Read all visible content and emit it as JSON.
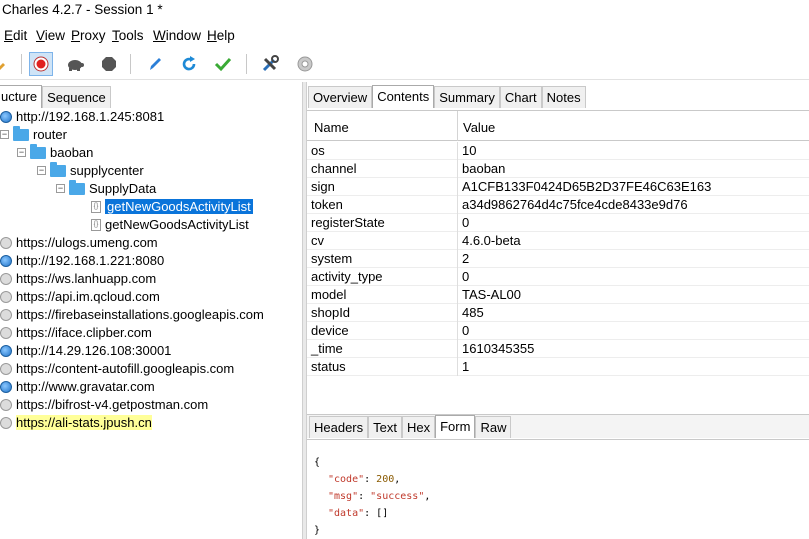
{
  "window": {
    "title": "Charles 4.2.7 - Session 1 *"
  },
  "menu": {
    "items": [
      {
        "u": "E",
        "rest": "dit"
      },
      {
        "u": "V",
        "rest": "iew"
      },
      {
        "u": "P",
        "rest": "roxy"
      },
      {
        "u": "T",
        "rest": "ools"
      },
      {
        "u": "W",
        "rest": "indow"
      },
      {
        "u": "H",
        "rest": "elp"
      }
    ]
  },
  "toolbar": {
    "icons": [
      "brush-icon",
      "record-icon",
      "throttle-turtle-icon",
      "breakpoint-hexagon-icon",
      "compose-pen-icon",
      "repeat-icon",
      "validate-check-icon",
      "tools-icon",
      "settings-gear-icon"
    ]
  },
  "left": {
    "tabs": [
      "ucture",
      "Sequence"
    ],
    "tree": [
      {
        "text": "http://192.168.1.245:8081",
        "icon": "globe"
      },
      {
        "text": "router",
        "icon": "folder"
      },
      {
        "text": "baoban",
        "icon": "folder"
      },
      {
        "text": "supplycenter",
        "icon": "folder"
      },
      {
        "text": "SupplyData",
        "icon": "folder"
      },
      {
        "text": "getNewGoodsActivityList",
        "icon": "file",
        "selected": true
      },
      {
        "text": "getNewGoodsActivityList",
        "icon": "file"
      },
      {
        "text": "https://ulogs.umeng.com",
        "icon": "lock"
      },
      {
        "text": "http://192.168.1.221:8080",
        "icon": "globe"
      },
      {
        "text": "https://ws.lanhuapp.com",
        "icon": "lock"
      },
      {
        "text": "https://api.im.qcloud.com",
        "icon": "lock"
      },
      {
        "text": "https://firebaseinstallations.googleapis.com",
        "icon": "lock"
      },
      {
        "text": "https://iface.clipber.com",
        "icon": "lock"
      },
      {
        "text": "http://14.29.126.108:30001",
        "icon": "globe"
      },
      {
        "text": "https://content-autofill.googleapis.com",
        "icon": "lock"
      },
      {
        "text": "http://www.gravatar.com",
        "icon": "globe"
      },
      {
        "text": "https://bifrost-v4.getpostman.com",
        "icon": "lock"
      },
      {
        "text": "https://ali-stats.jpush.cn",
        "icon": "lock",
        "highlight": true
      }
    ]
  },
  "right": {
    "tabs": [
      "Overview",
      "Contents",
      "Summary",
      "Chart",
      "Notes"
    ],
    "table": {
      "headers": [
        "Name",
        "Value"
      ],
      "rows": [
        [
          "os",
          "10"
        ],
        [
          "channel",
          "baoban"
        ],
        [
          "sign",
          "A1CFB133F0424D65B2D37FE46C63E163"
        ],
        [
          "token",
          "a34d9862764d4c75fce4cde8433e9d76"
        ],
        [
          "registerState",
          "0"
        ],
        [
          "cv",
          "4.6.0-beta"
        ],
        [
          "system",
          "2"
        ],
        [
          "activity_type",
          "0"
        ],
        [
          "model",
          "TAS-AL00"
        ],
        [
          "shopId",
          "485"
        ],
        [
          "device",
          "0"
        ],
        [
          "_time",
          "1610345355"
        ],
        [
          "status",
          "1"
        ]
      ]
    },
    "lower_tabs": [
      "Headers",
      "Text",
      "Hex",
      "Form",
      "Raw"
    ],
    "json": {
      "open": "{",
      "code_key": "\"code\"",
      "code_val": "200",
      "msg_key": "\"msg\"",
      "msg_val": "\"success\"",
      "data_key": "\"data\"",
      "data_val": "[]",
      "close": "}"
    }
  }
}
